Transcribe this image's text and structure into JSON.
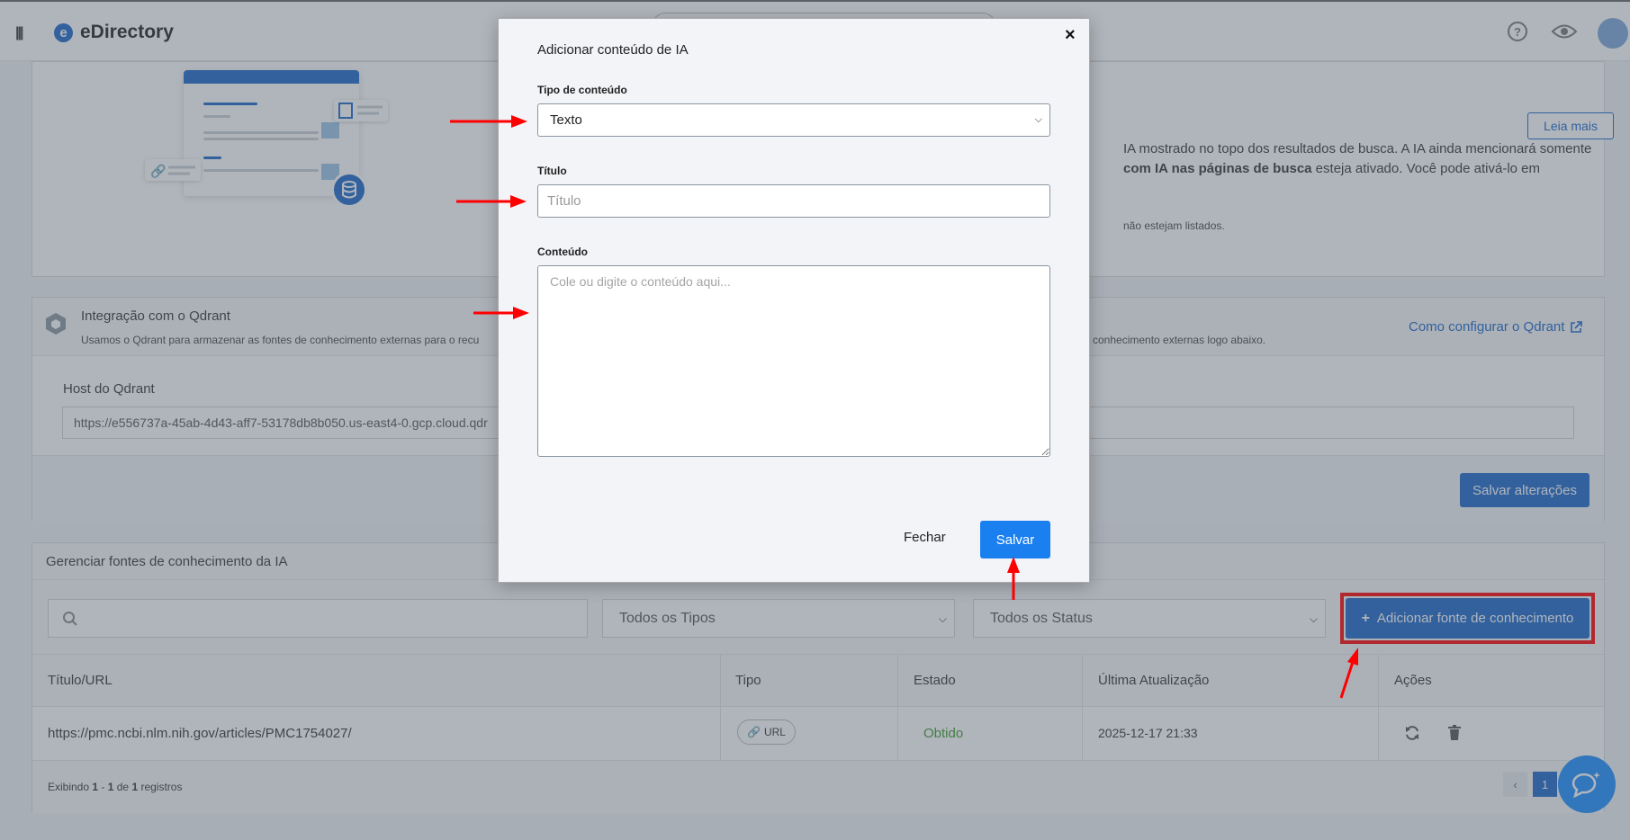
{
  "app": {
    "name": "eDirectory",
    "logo_letter": "e"
  },
  "header": {
    "icons": [
      "help-icon",
      "eye-icon"
    ]
  },
  "hero": {
    "button_label": "Leia mais",
    "line1": "IA mostrado no topo dos resultados de busca. A IA ainda mencionará somente",
    "line2_bold": "com IA nas páginas de busca",
    "line2_rest": " esteja ativado. Você pode ativá-lo em",
    "line3": "não estejam listados."
  },
  "qdrant": {
    "title": "Integração com o Qdrant",
    "description": "Usamos o Qdrant para armazenar as fontes de conhecimento externas para o recu",
    "description_right": "conhecimento externas logo abaixo.",
    "link": "Como configurar o Qdrant",
    "host_label": "Host do Qdrant",
    "host_value": "https://e556737a-45ab-4d43-aff7-53178db8b050.us-east4-0.gcp.cloud.qdr",
    "save_button": "Salvar alterações"
  },
  "knowledge": {
    "title": "Gerenciar fontes de conhecimento da IA",
    "filter_type": "Todos os Tipos",
    "filter_status": "Todos os Status",
    "add_button": "Adicionar fonte de conhecimento",
    "columns": [
      "Título/URL",
      "Tipo",
      "Estado",
      "Última Atualização",
      "Ações"
    ],
    "rows": [
      {
        "title": "https://pmc.ncbi.nlm.nih.gov/articles/PMC1754027/",
        "type": "URL",
        "status": "Obtido",
        "updated": "2025-12-17 21:33"
      }
    ],
    "footer": {
      "prefix": "Exibindo ",
      "from": "1",
      "sep": " - ",
      "to": "1",
      "of": " de ",
      "total": "1",
      "suffix": " registros"
    },
    "pagination": {
      "prev": "‹",
      "current": "1"
    }
  },
  "modal": {
    "title": "Adicionar conteúdo de IA",
    "type_label": "Tipo de conteúdo",
    "type_value": "Texto",
    "title_label": "Título",
    "title_placeholder": "Título",
    "content_label": "Conteúdo",
    "content_placeholder": "Cole ou digite o conteúdo aqui...",
    "close_label": "Fechar",
    "save_label": "Salvar",
    "close_icon": "×"
  },
  "colors": {
    "primary": "#1a66c9",
    "save": "#1a80f0",
    "annotation": "#ff0000",
    "success": "#3a9a2a"
  }
}
